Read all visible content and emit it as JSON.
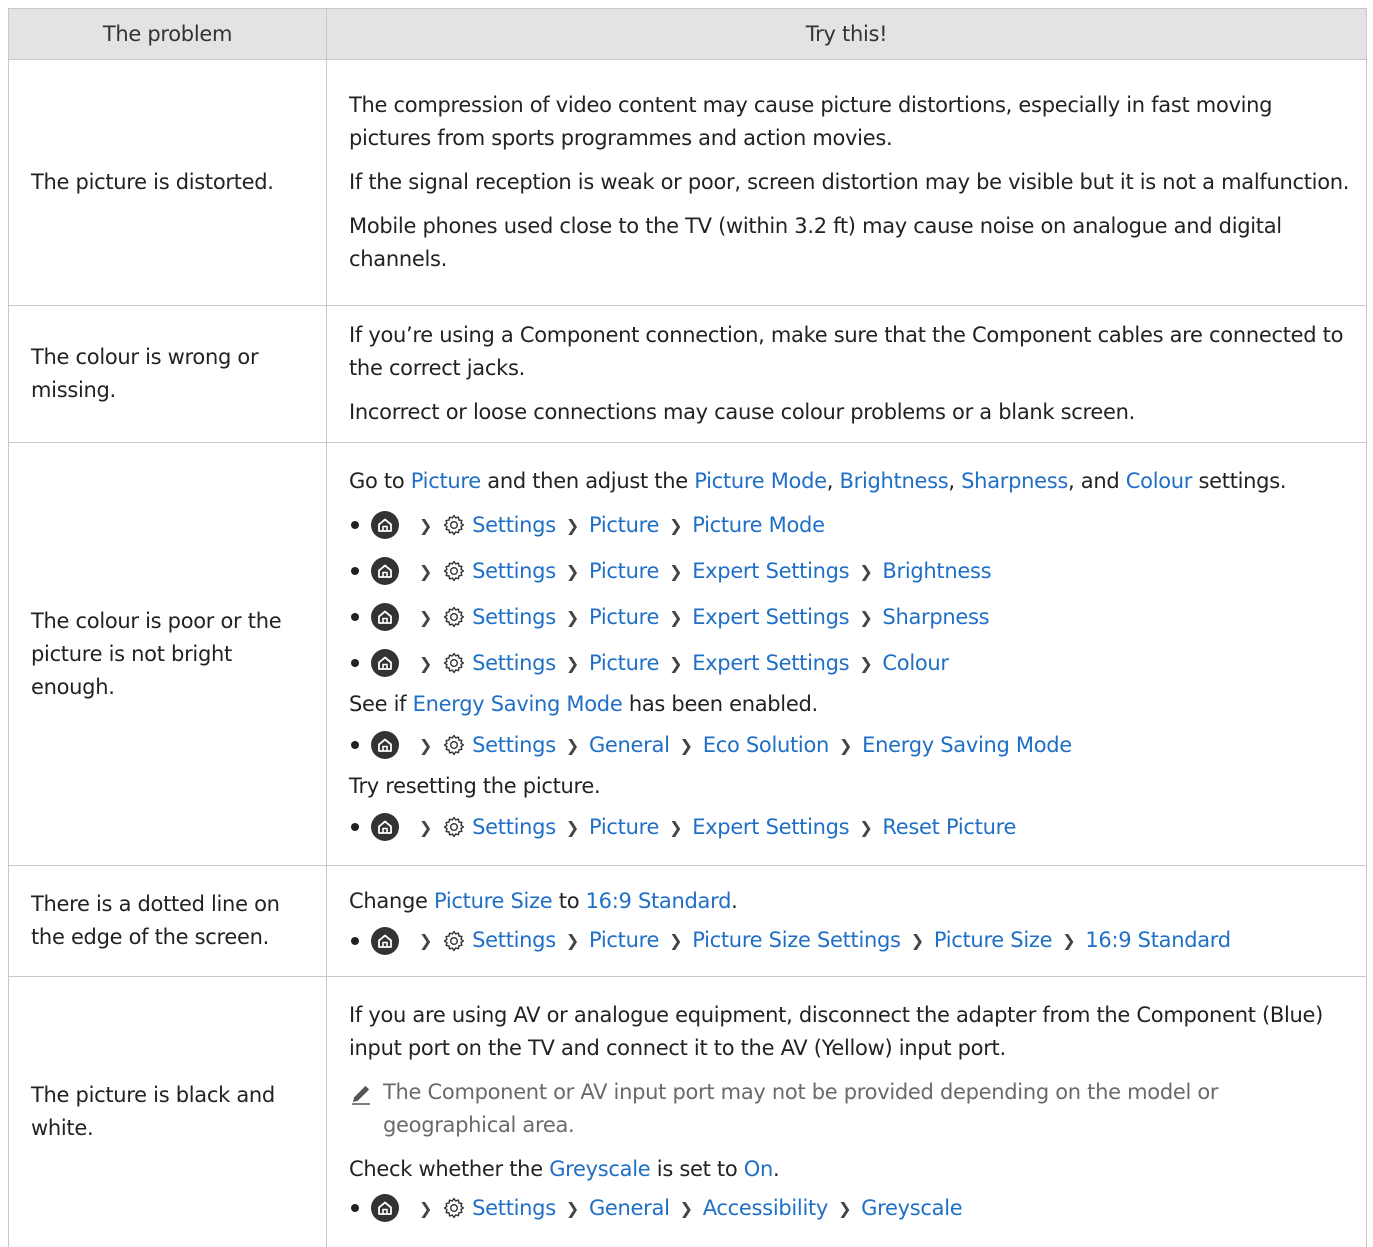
{
  "header": {
    "col1": "The problem",
    "col2": "Try this!"
  },
  "sep": ">",
  "rows": [
    {
      "problem": "The picture is distorted.",
      "paras": [
        "The compression of video content may cause picture distortions, especially in fast moving pictures from sports programmes and action movies.",
        "If the signal reception is weak or poor, screen distortion may be visible but it is not a malfunction.",
        "Mobile phones used close to the TV (within 3.2 ft) may cause noise on analogue and digital channels."
      ]
    },
    {
      "problem": "The colour is wrong or missing.",
      "paras": [
        "If you’re using a Component connection, make sure that the Component cables are connected to the correct jacks.",
        "Incorrect or loose connections may cause colour problems or a blank screen."
      ]
    },
    {
      "problem": "The colour is poor or the picture is not bright enough.",
      "intro": {
        "t1": "Go to ",
        "l1": "Picture",
        "t2": " and then adjust the ",
        "l2": "Picture Mode",
        "t3": ", ",
        "l3": "Brightness",
        "t4": ", ",
        "l4": "Sharpness",
        "t5": ", and ",
        "l5": "Colour",
        "t6": " settings."
      },
      "paths": [
        [
          "Settings",
          "Picture",
          "Picture Mode"
        ],
        [
          "Settings",
          "Picture",
          "Expert Settings",
          "Brightness"
        ],
        [
          "Settings",
          "Picture",
          "Expert Settings",
          "Sharpness"
        ],
        [
          "Settings",
          "Picture",
          "Expert Settings",
          "Colour"
        ]
      ],
      "energy": {
        "t1": "See if ",
        "l1": "Energy Saving Mode",
        "t2": " has been enabled."
      },
      "energy_path": [
        "Settings",
        "General",
        "Eco Solution",
        "Energy Saving Mode"
      ],
      "reset": "Try resetting the picture.",
      "reset_path": [
        "Settings",
        "Picture",
        "Expert Settings",
        "Reset Picture"
      ]
    },
    {
      "problem": "There is a dotted line on the edge of the screen.",
      "intro": {
        "t1": "Change ",
        "l1": "Picture Size",
        "t2": " to ",
        "l2": "16:9 Standard",
        "t3": "."
      },
      "path": [
        "Settings",
        "Picture",
        "Picture Size Settings",
        "Picture Size",
        "16:9 Standard"
      ]
    },
    {
      "problem": "The picture is black and white.",
      "para": "If you are using AV or analogue equipment, disconnect the adapter from the Component (Blue) input port on the TV and connect it to the AV (Yellow) input port.",
      "note": "The Component or AV input port may not be provided depending on the model or geographical area.",
      "check": {
        "t1": "Check whether the ",
        "l1": "Greyscale",
        "t2": " is set to ",
        "l2": "On",
        "t3": "."
      },
      "path": [
        "Settings",
        "General",
        "Accessibility",
        "Greyscale"
      ]
    }
  ],
  "colors": {
    "link": "#1f6fc7",
    "header_bg": "#e3e3e3",
    "border": "#c8c8c8"
  }
}
